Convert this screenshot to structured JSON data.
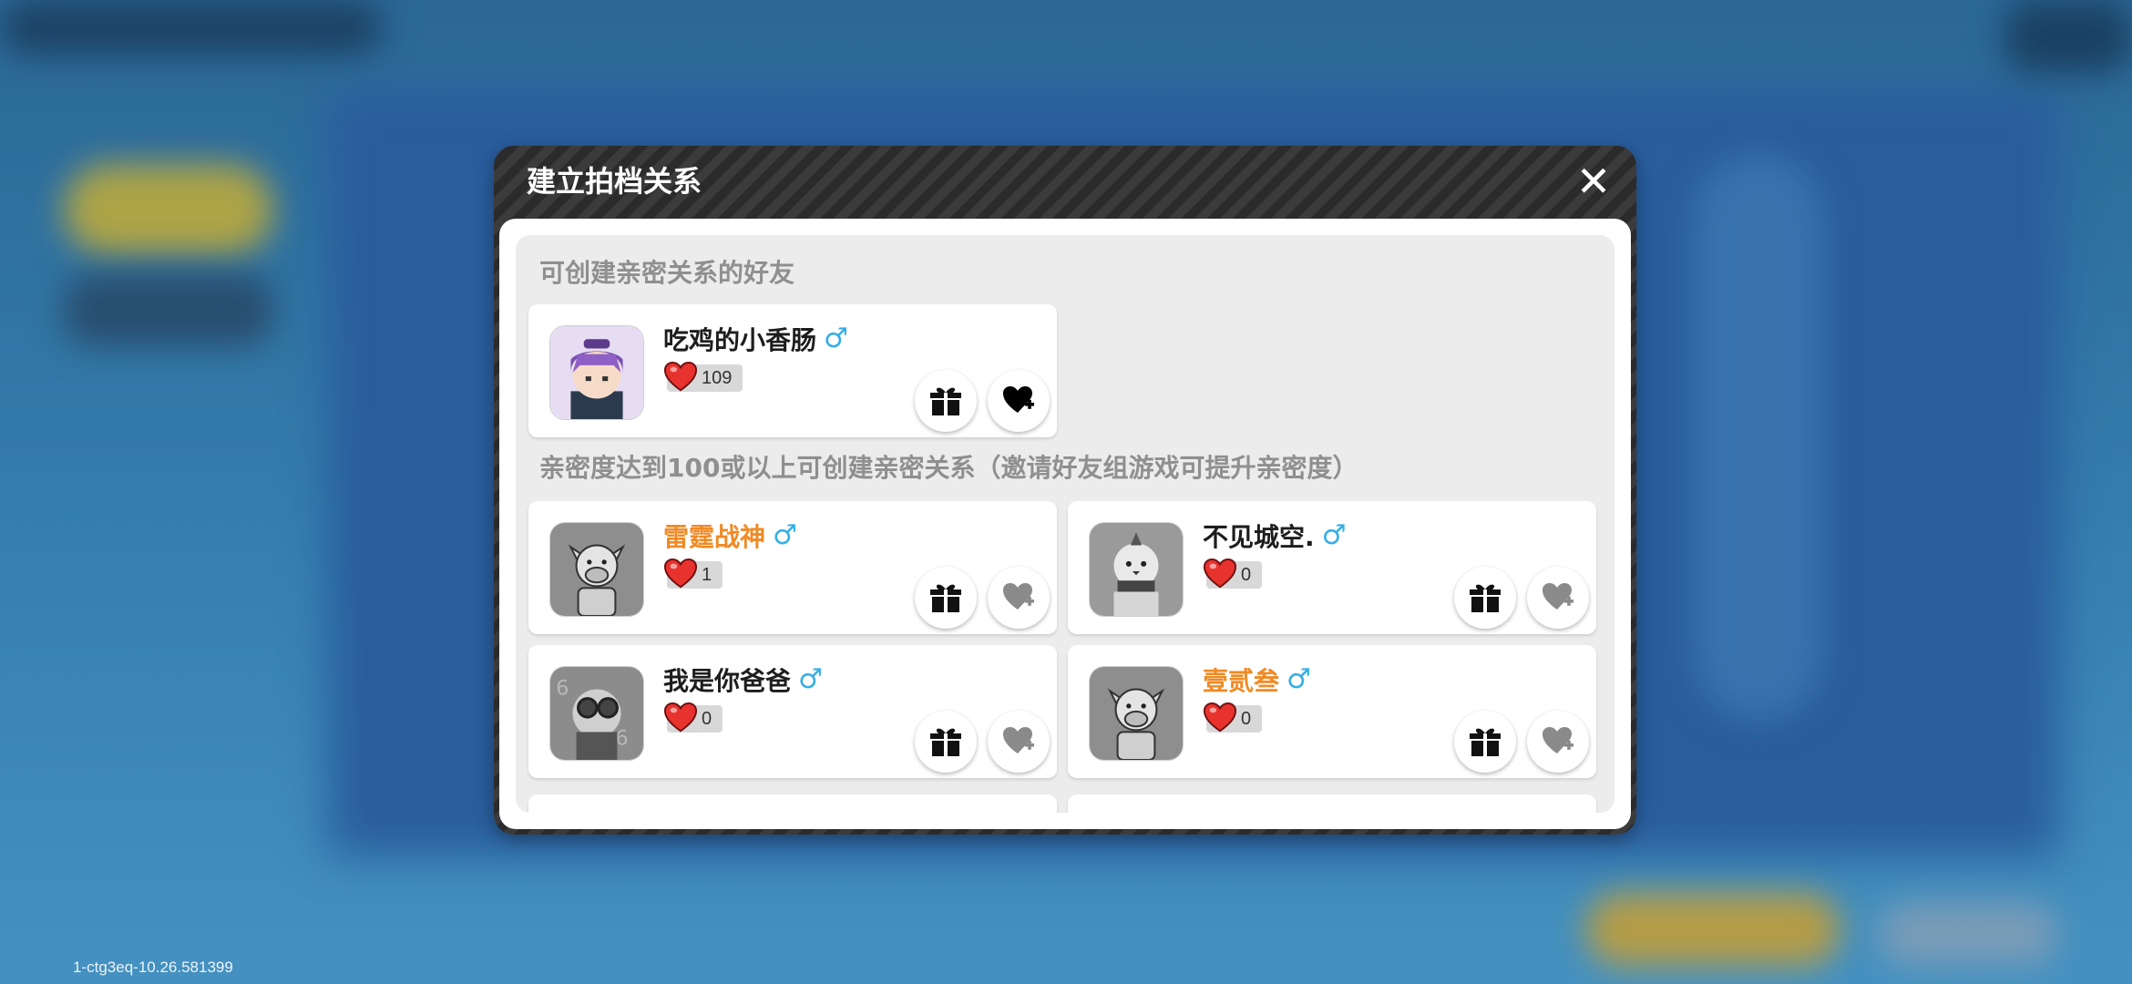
{
  "version_label": "1-ctg3eq-10.26.581399",
  "dialog": {
    "title": "建立拍档关系",
    "close_icon": "✕"
  },
  "sections": {
    "available_title": "可创建亲密关系的好友",
    "locked_title": "亲密度达到100或以上可创建亲密关系（邀请好友组游戏可提升亲密度）"
  },
  "friends_available": [
    {
      "name": "吃鸡的小香肠",
      "gender": "♂",
      "affinity": "109",
      "name_color": "default",
      "avatar": "purple-hair-avatar"
    }
  ],
  "friends_locked": [
    {
      "name": "雷霆战神",
      "gender": "♂",
      "affinity": "1",
      "name_color": "orange",
      "avatar": "cow-avatar"
    },
    {
      "name": "不见城空.",
      "gender": "♂",
      "affinity": "0",
      "name_color": "default",
      "avatar": "bird-avatar"
    },
    {
      "name": "我是你爸爸",
      "gender": "♂",
      "affinity": "0",
      "name_color": "default",
      "avatar": "goggles-avatar"
    },
    {
      "name": "壹贰叁",
      "gender": "♂",
      "affinity": "0",
      "name_color": "orange",
      "avatar": "cow-avatar"
    }
  ],
  "colors": {
    "orange_name": "#f08a24",
    "gender_male": "#35aee6",
    "heart_red": "#e8322e",
    "heart_gray": "#8a8a8a"
  },
  "icons": {
    "gift": "gift-icon",
    "heart_add": "heart-plus-icon",
    "affinity": "heart-icon"
  }
}
